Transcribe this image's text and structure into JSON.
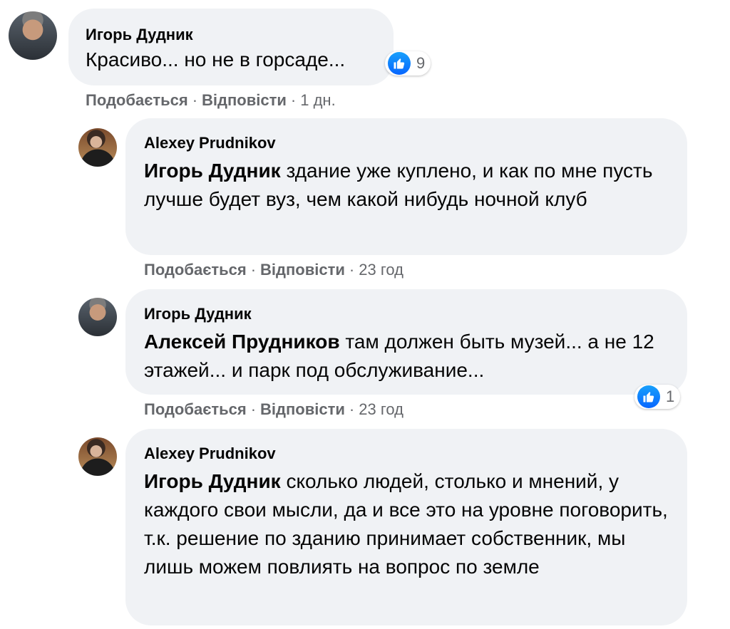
{
  "comments": [
    {
      "author": "Игорь Дудник",
      "mention": "",
      "text": "Красиво... но не в горсаде...",
      "like_label": "Подобається",
      "reply_label": "Відповісти",
      "time": "1 дн.",
      "reactions": "9"
    },
    {
      "author": "Alexey Prudnikov",
      "mention": "Игорь Дудник",
      "text": "здание уже куплено, и как по мне пусть лучше будет вуз, чем какой нибудь ночной клуб",
      "like_label": "Подобається",
      "reply_label": "Відповісти",
      "time": "23 год"
    },
    {
      "author": "Игорь Дудник",
      "mention": "Алексей Прудников",
      "text": "там должен быть музей... а не 12 этажей... и парк под обслуживание...",
      "like_label": "Подобається",
      "reply_label": "Відповісти",
      "time": "23 год",
      "reactions": "1"
    },
    {
      "author": "Alexey Prudnikov",
      "mention": "Игорь Дудник",
      "text": "сколько людей, столько и мнений, у каждого свои мысли, да и все это на уровне поговорить, т.к. решение по зданию принимает собственник, мы лишь можем повлиять на вопрос по земле"
    }
  ],
  "icons": {
    "reaction": "like-icon"
  },
  "colors": {
    "bubble": "#f0f2f5",
    "like_blue": "#0866ff",
    "meta": "#65676b"
  }
}
